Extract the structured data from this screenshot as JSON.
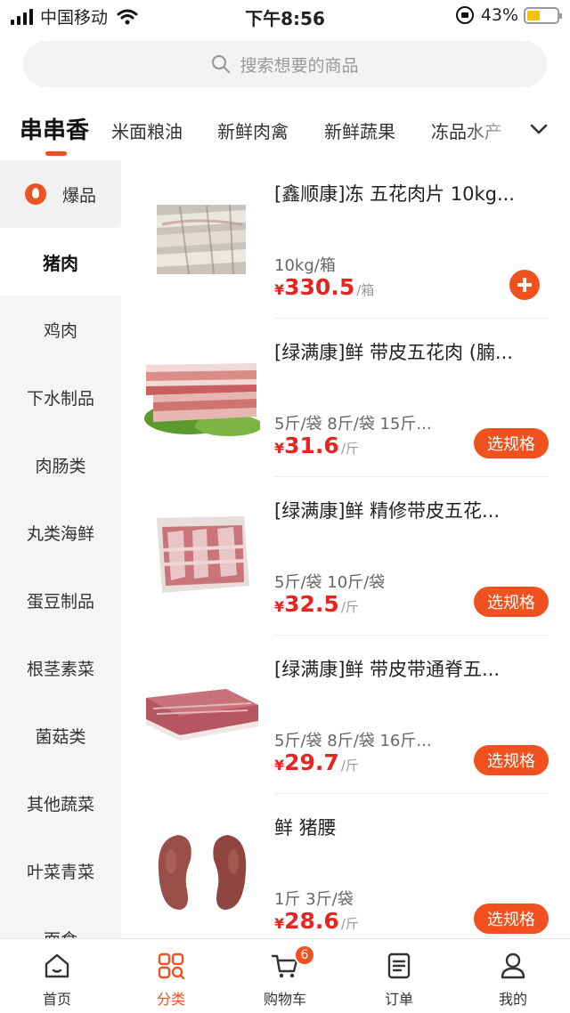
{
  "status_bar": {
    "carrier": "中国移动",
    "time": "下午8:56",
    "battery": "43%",
    "battery_level": 0.43
  },
  "search": {
    "placeholder": "搜索想要的商品"
  },
  "top_tabs": [
    {
      "label": "串串香",
      "active": true
    },
    {
      "label": "米面粮油"
    },
    {
      "label": "新鲜肉禽"
    },
    {
      "label": "新鲜蔬果"
    },
    {
      "label": "冻品水产"
    }
  ],
  "sidebar": {
    "items": [
      {
        "label": "爆品",
        "hot": true
      },
      {
        "label": "猪肉",
        "active": true
      },
      {
        "label": "鸡肉"
      },
      {
        "label": "下水制品"
      },
      {
        "label": "肉肠类"
      },
      {
        "label": "丸类海鲜"
      },
      {
        "label": "蛋豆制品"
      },
      {
        "label": "根茎素菜"
      },
      {
        "label": "菌菇类"
      },
      {
        "label": "其他蔬菜"
      },
      {
        "label": "叶菜青菜"
      },
      {
        "label": "面食"
      }
    ]
  },
  "products": [
    {
      "name": "[鑫顺康]冻 五花肉片 10kg...",
      "spec": "10kg/箱",
      "currency": "¥",
      "price": "330.5",
      "unit": "/箱",
      "action": "add"
    },
    {
      "name": "[绿满康]鲜 带皮五花肉 (腩...",
      "spec": "5斤/袋 8斤/袋 15斤...",
      "currency": "¥",
      "price": "31.6",
      "unit": "/斤",
      "action": "选规格"
    },
    {
      "name": "[绿满康]鲜 精修带皮五花...",
      "spec": "5斤/袋 10斤/袋",
      "currency": "¥",
      "price": "32.5",
      "unit": "/斤",
      "action": "选规格"
    },
    {
      "name": "[绿满康]鲜 带皮带通脊五...",
      "spec": "5斤/袋 8斤/袋 16斤...",
      "currency": "¥",
      "price": "29.7",
      "unit": "/斤",
      "action": "选规格"
    },
    {
      "name": "鲜 猪腰",
      "spec": "1斤 3斤/袋",
      "currency": "¥",
      "price": "28.6",
      "unit": "/斤",
      "action": "选规格"
    }
  ],
  "bottom_nav": [
    {
      "label": "首页",
      "icon": "home-icon"
    },
    {
      "label": "分类",
      "icon": "category-icon",
      "active": true
    },
    {
      "label": "购物车",
      "icon": "cart-icon",
      "badge": "6"
    },
    {
      "label": "订单",
      "icon": "order-icon"
    },
    {
      "label": "我的",
      "icon": "user-icon"
    }
  ],
  "colors": {
    "accent": "#f05122",
    "price": "#e6251f",
    "sidebar_bg": "#f5f5f5"
  }
}
